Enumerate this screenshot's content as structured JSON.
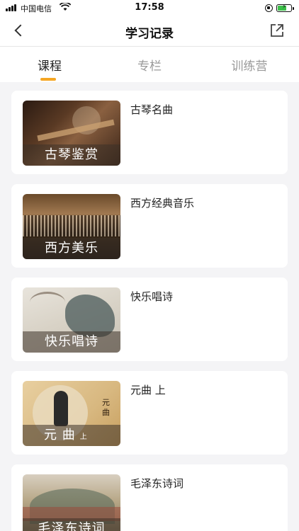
{
  "status_bar": {
    "carrier": "中国电信",
    "time": "17:58"
  },
  "nav": {
    "title": "学习记录"
  },
  "tabs": [
    {
      "label": "课程",
      "active": true
    },
    {
      "label": "专栏",
      "active": false
    },
    {
      "label": "训练营",
      "active": false
    }
  ],
  "colors": {
    "accent": "#f5a623",
    "background": "#f4f4f6"
  },
  "courses": [
    {
      "title": "古琴名曲",
      "thumb_label": "古琴鉴赏"
    },
    {
      "title": "西方经典音乐",
      "thumb_label": "西方美乐"
    },
    {
      "title": "快乐唱诗",
      "thumb_label": "快乐唱诗"
    },
    {
      "title": "元曲 上",
      "thumb_label": "元 曲",
      "thumb_sub": "上",
      "thumb_vertical": "元曲"
    },
    {
      "title": "毛泽东诗词",
      "thumb_label": "毛泽东诗词"
    }
  ]
}
